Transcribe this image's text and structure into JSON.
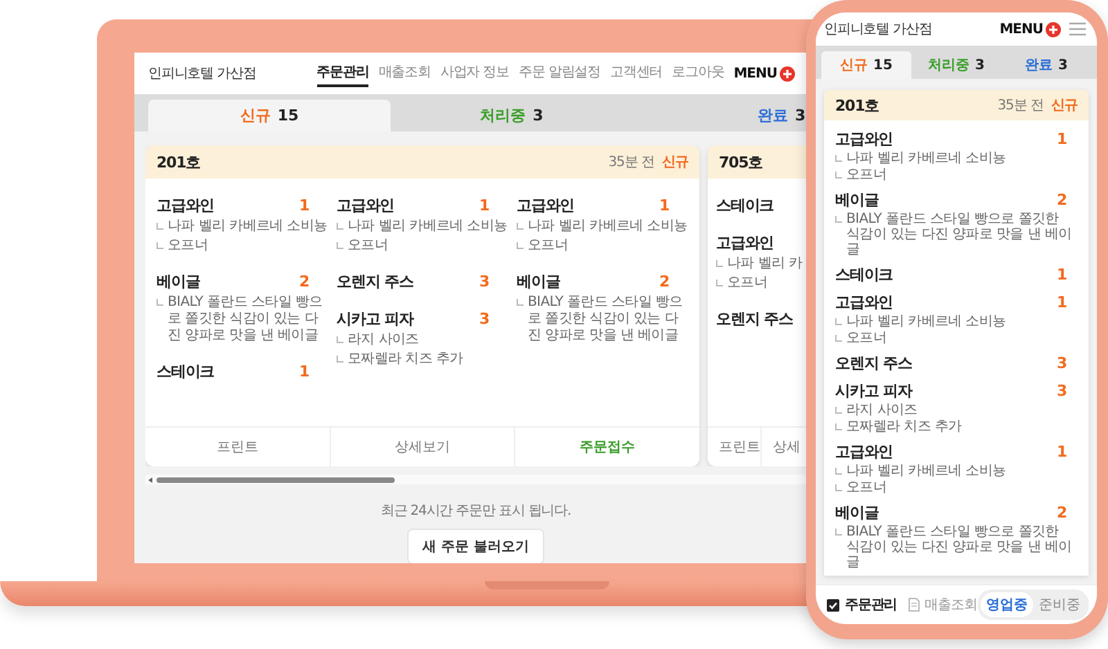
{
  "laptop": {
    "header": {
      "store_name": "인피니호텔 가산점",
      "nav": [
        {
          "label": "주문관리",
          "selected": true
        },
        {
          "label": "매출조회",
          "selected": false
        },
        {
          "label": "사업자 정보",
          "selected": false
        },
        {
          "label": "주문 알림설정",
          "selected": false
        },
        {
          "label": "고객센터",
          "selected": false
        },
        {
          "label": "로그아웃",
          "selected": false
        }
      ],
      "menu_label": "MENU"
    },
    "tabs": [
      {
        "label": "신규",
        "count": "15",
        "color": "#f26b1d",
        "selected": true
      },
      {
        "label": "처리중",
        "count": "3",
        "color": "#3a9e2a",
        "selected": false
      },
      {
        "label": "완료",
        "count": "3",
        "color": "#2b6fd8",
        "selected": false
      }
    ],
    "orders": [
      {
        "room": "201호",
        "time": "35분 전",
        "status": "신규",
        "columns": [
          [
            {
              "name": "고급와인",
              "qty": "1",
              "options": [
                "나파 벨리 카베르네 소비뇽",
                "오프너"
              ]
            },
            {
              "name": "베이글",
              "qty": "2",
              "options": [
                "BIALY 폴란드 스타일 빵으로 쫄깃한 식감이 있는 다진 양파로 맛을 낸 베이글"
              ]
            },
            {
              "name": "스테이크",
              "qty": "1"
            }
          ],
          [
            {
              "name": "고급와인",
              "qty": "1",
              "options": [
                "나파 벨리 카베르네 소비뇽",
                "오프너"
              ]
            },
            {
              "name": "오렌지 주스",
              "qty": "3"
            },
            {
              "name": "시카고 피자",
              "qty": "3",
              "options": [
                "라지 사이즈",
                "모짜렐라 치즈 추가"
              ]
            }
          ],
          [
            {
              "name": "고급와인",
              "qty": "1",
              "options": [
                "나파 벨리 카베르네 소비뇽",
                "오프너"
              ]
            },
            {
              "name": "베이글",
              "qty": "2",
              "options": [
                "BIALY 폴란드 스타일 빵으로 쫄깃한 식감이 있는 다진 양파로 맛을 낸 베이글"
              ]
            }
          ]
        ],
        "actions": [
          {
            "label": "프린트",
            "kind": "plain"
          },
          {
            "label": "상세보기",
            "kind": "plain"
          },
          {
            "label": "주문접수",
            "kind": "accept"
          }
        ]
      },
      {
        "room": "705호",
        "columns": [
          [
            {
              "name": "스테이크"
            },
            {
              "name": "고급와인",
              "options": [
                "나파 벨리 카",
                "오프너"
              ]
            },
            {
              "name": "오렌지 주스"
            }
          ]
        ],
        "actions": [
          {
            "label": "프린트",
            "kind": "plain"
          },
          {
            "label": "상세",
            "kind": "plain"
          }
        ]
      }
    ],
    "notice": "최근 24시간 주문만 표시 됩니다.",
    "reload_button": "새 주문 불러오기"
  },
  "phone": {
    "header": {
      "store_name": "인피니호텔 가산점",
      "menu_label": "MENU"
    },
    "tabs": [
      {
        "label": "신규",
        "count": "15",
        "color": "#f26b1d",
        "selected": true
      },
      {
        "label": "처리중",
        "count": "3",
        "color": "#3a9e2a",
        "selected": false
      },
      {
        "label": "완료",
        "count": "3",
        "color": "#2b6fd8",
        "selected": false
      }
    ],
    "order": {
      "room": "201호",
      "time": "35분 전",
      "status": "신규",
      "items": [
        {
          "name": "고급와인",
          "qty": "1",
          "options": [
            "나파 벨리 카베르네 소비뇽",
            "오프너"
          ]
        },
        {
          "name": "베이글",
          "qty": "2",
          "options": [
            "BIALY 폴란드 스타일 빵으로 쫄깃한 식감이 있는 다진 양파로 맛을 낸 베이글"
          ]
        },
        {
          "name": "스테이크",
          "qty": "1"
        },
        {
          "name": "고급와인",
          "qty": "1",
          "options": [
            "나파 벨리 카베르네 소비뇽",
            "오프너"
          ]
        },
        {
          "name": "오렌지 주스",
          "qty": "3"
        },
        {
          "name": "시카고 피자",
          "qty": "3",
          "options": [
            "라지 사이즈",
            "모짜렐라 치즈 추가"
          ]
        },
        {
          "name": "고급와인",
          "qty": "1",
          "options": [
            "나파 벨리 카베르네 소비뇽",
            "오프너"
          ]
        },
        {
          "name": "베이글",
          "qty": "2",
          "options": [
            "BIALY 폴란드 스타일 빵으로 쫄깃한 식감이 있는 다진 양파로 맛을 낸 베이글"
          ]
        }
      ]
    },
    "bottom_nav": [
      {
        "label": "주문관리",
        "kind": "check",
        "selected": true
      },
      {
        "label": "매출조회",
        "kind": "document",
        "selected": false
      }
    ],
    "status_toggle": [
      {
        "label": "영업중",
        "selected": true
      },
      {
        "label": "준비중",
        "selected": false
      }
    ]
  }
}
